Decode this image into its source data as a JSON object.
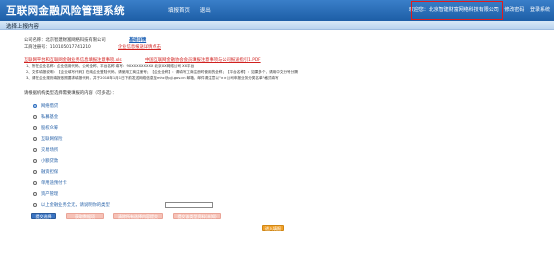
{
  "header": {
    "title": "互联网金融风险管理系统",
    "nav": [
      "填报首页",
      "退出"
    ],
    "welcome": "欢迎您：",
    "company": "北京智建財富网络科技有限公司",
    "links": [
      "修改密码",
      "登录系统"
    ]
  },
  "subbar": {
    "label": "选择上报内容"
  },
  "company_info": {
    "name_label": "公司名称：",
    "name_value": "北京智建财富网络科技有限公司",
    "name_link": "基础详情",
    "reg_label": "工商注册号：",
    "reg_value": "110105017741210",
    "reg_link": "企业信息报送详情点击"
  },
  "notices": {
    "download_1": "互联网平台和互联网金融业务信息填报注意事项.xls",
    "download_2": "中国互联网金融协会会员填报注意事项与公司报送指引1.PDF",
    "line_1": "1、所在企业名称：企业信用代码、公司全称、平台名称 填写：9XXXXXXXXXX 北京XX网络公司 XX平台",
    "line_2": "2、文件填报说明：【企业填写代码】在纯企业登陆代码，请使用工商注册号；【企业全称】：请填写工商注册时使用的全称；【平台名称】：如果多个，请用中文分号分隔",
    "line_3": "3、请在企业规则填报依照要求填报代码，并于2018年1月1日下前发送网络信息至mhc@pjj.gov.cn 邮箱，邮件请注意以\"××公司申报业务分类名单\"格式填写"
  },
  "prompt": "请根据机构类型选择需要填报的内容（可多选）：",
  "options": [
    "网络借贷",
    "私募基金",
    "股权众筹",
    "互联网保险",
    "交易场所",
    "小额贷款",
    "融资担保",
    "单用途预付卡",
    "资产管理",
    "以上金融业务全无，请说明你的类型"
  ],
  "selected_index": 0,
  "buttons": {
    "submit": "提交选择",
    "action_1": "获取数据项",
    "action_2": "清除所有选择内容提交",
    "action_3": "提交该类型资料(未知)",
    "enter": "进入填报"
  }
}
